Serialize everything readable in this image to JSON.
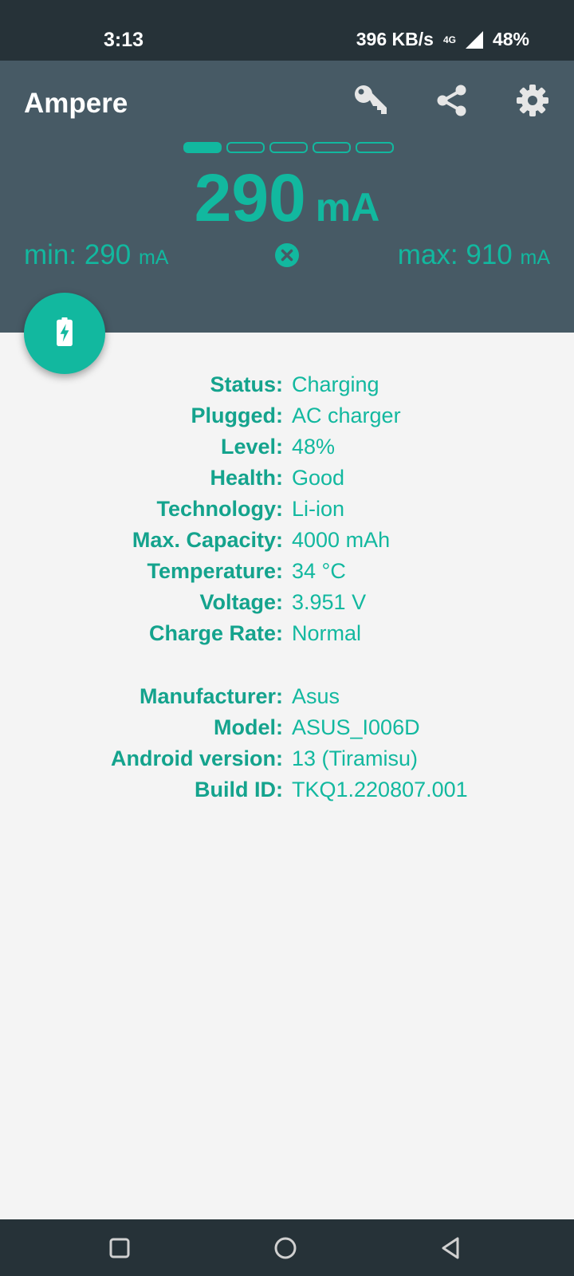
{
  "status_bar": {
    "time": "3:13",
    "network_speed": "396 KB/s",
    "network_type": "4G",
    "battery": "48%"
  },
  "header": {
    "title": "Ampere",
    "icons": [
      "key-icon",
      "share-icon",
      "settings-icon"
    ],
    "pager": {
      "total": 5,
      "active": 0
    },
    "current": {
      "value": "290",
      "unit": "mA"
    },
    "min": {
      "label": "min: 290",
      "unit": "mA"
    },
    "max": {
      "label": "max: 910",
      "unit": "mA"
    }
  },
  "fab_icon": "battery-charging-icon",
  "battery_info": [
    {
      "key": "Status:",
      "value": "Charging"
    },
    {
      "key": "Plugged:",
      "value": "AC charger"
    },
    {
      "key": "Level:",
      "value": "48%"
    },
    {
      "key": "Health:",
      "value": "Good"
    },
    {
      "key": "Technology:",
      "value": "Li-ion"
    },
    {
      "key": "Max. Capacity:",
      "value": "4000 mAh"
    },
    {
      "key": "Temperature:",
      "value": "34 °C"
    },
    {
      "key": "Voltage:",
      "value": "3.951 V"
    },
    {
      "key": "Charge Rate:",
      "value": "Normal"
    }
  ],
  "device_info": [
    {
      "key": "Manufacturer:",
      "value": "Asus"
    },
    {
      "key": "Model:",
      "value": "ASUS_I006D"
    },
    {
      "key": "Android version:",
      "value": "13 (Tiramisu)"
    },
    {
      "key": "Build ID:",
      "value": "TKQ1.220807.001"
    }
  ],
  "colors": {
    "accent": "#12b89f",
    "label": "#14a38d",
    "header_bg": "#475a65",
    "status_bar_bg": "#263238",
    "content_bg": "#f4f4f4"
  }
}
